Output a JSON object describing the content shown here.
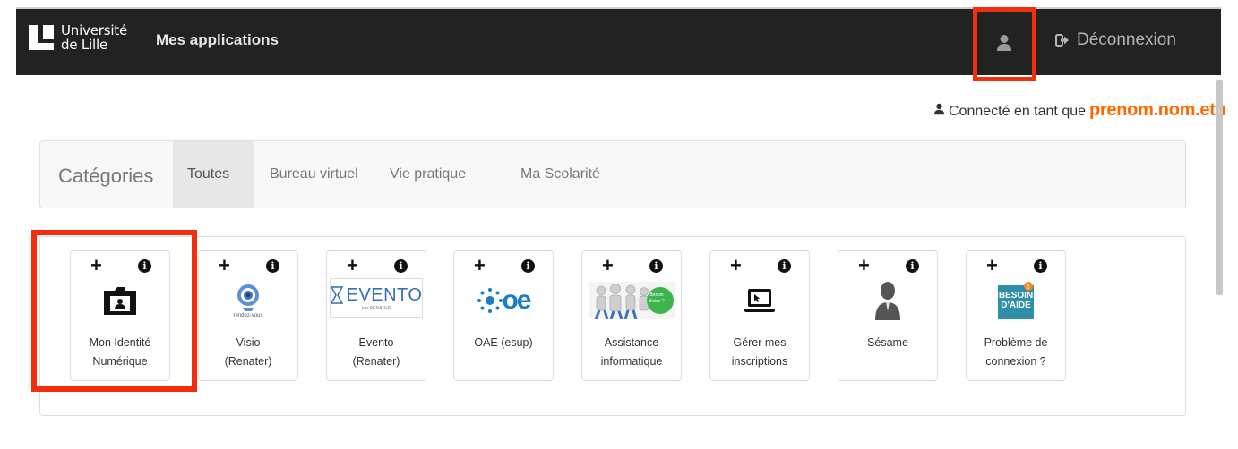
{
  "navbar": {
    "logo_line1": "Université",
    "logo_line2": "de Lille",
    "brand": "Mes applications",
    "user_icon": "user-icon",
    "logout_label": "Déconnexion",
    "logout_icon": "sign-out-icon",
    "background": "#222222"
  },
  "connected": {
    "prefix": "Connecté en tant que",
    "username": "prenom.nom.etu"
  },
  "categories": {
    "title": "Catégories",
    "tabs": [
      {
        "label": "Toutes",
        "active": true
      },
      {
        "label": "Bureau virtuel",
        "active": false
      },
      {
        "label": "Vie pratique",
        "active": false
      },
      {
        "label": "Ma Scolarité",
        "active": false
      }
    ]
  },
  "apps": [
    {
      "line1": "Mon Identité",
      "line2": "Numérique",
      "icon": "id-card-icon"
    },
    {
      "line1": "Visio",
      "line2": "(Renater)",
      "icon": "rendez-vous-webcam-icon",
      "icon_text": "rendez-vous"
    },
    {
      "line1": "Evento",
      "line2": "(Renater)",
      "icon": "evento-logo-icon",
      "icon_text": "EVENTO",
      "icon_subtext": "par RENATER"
    },
    {
      "line1": "OAE (esup)",
      "line2": "",
      "icon": "oae-logo-icon",
      "icon_text": "oe"
    },
    {
      "line1": "Assistance",
      "line2": "informatique",
      "icon": "assistance-people-icon",
      "icon_text": "Besoin d'aide ?"
    },
    {
      "line1": "Gérer mes",
      "line2": "inscriptions",
      "icon": "laptop-cursor-icon"
    },
    {
      "line1": "Sésame",
      "line2": "",
      "icon": "person-silhouette-icon"
    },
    {
      "line1": "Problème de",
      "line2": "connexion ?",
      "icon": "besoin-aide-icon",
      "icon_text": "BESOIN D'AIDE"
    }
  ],
  "tile_controls": {
    "add": "+",
    "info": "i"
  },
  "colors": {
    "highlight": "#f22e0c",
    "username": "#ff6a00",
    "oae_blue": "#1a7fc4",
    "help_teal": "#2f8fa8"
  }
}
